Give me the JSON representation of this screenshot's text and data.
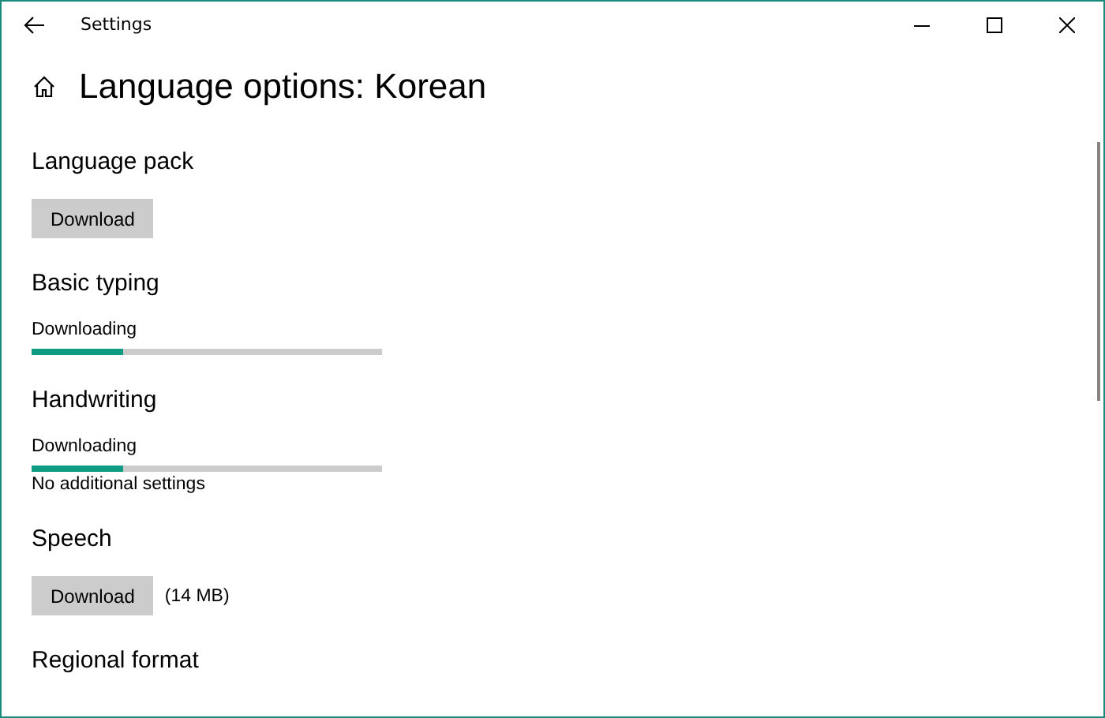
{
  "window": {
    "title": "Settings"
  },
  "page": {
    "title": "Language options: Korean"
  },
  "sections": [
    {
      "title": "Language pack",
      "kind": "button",
      "button": "Download"
    },
    {
      "title": "Basic typing",
      "kind": "progress",
      "status": "Downloading",
      "level": 0.26
    },
    {
      "title": "Handwriting",
      "kind": "progress",
      "status": "Downloading",
      "level": 0.26,
      "note": "No additional settings"
    },
    {
      "title": "Speech",
      "kind": "button",
      "button": "Download",
      "note": "(14 MB)"
    },
    {
      "title": "Regional format",
      "kind": "heading"
    }
  ]
}
